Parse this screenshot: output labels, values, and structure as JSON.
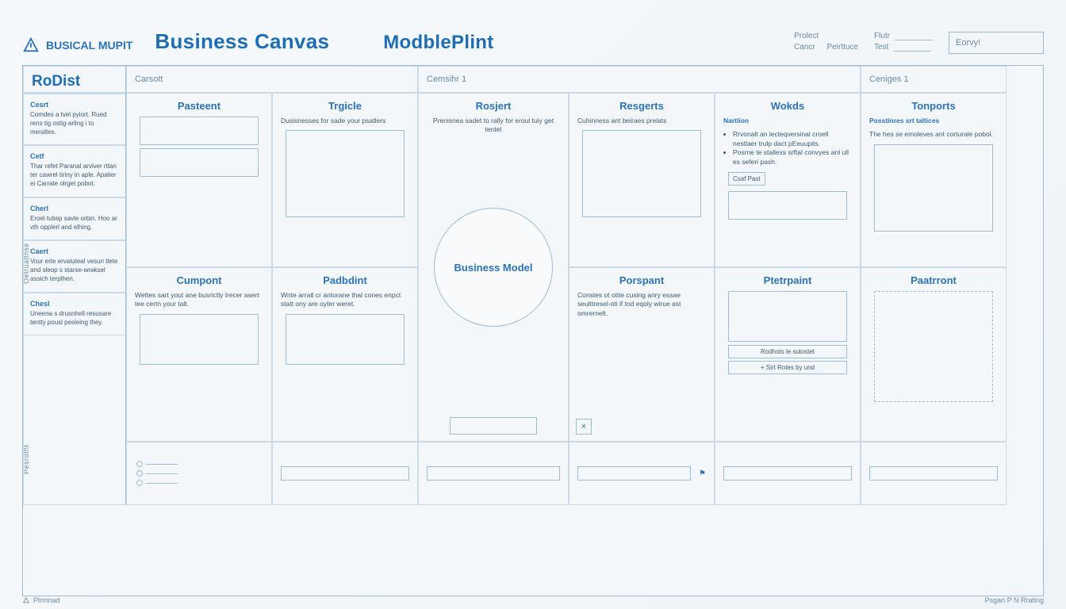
{
  "header": {
    "brand": "BUSICAL MUPIT",
    "title": "Business Canvas",
    "subtitle": "ModblePlint",
    "meta": {
      "c1a": "Prolect",
      "c1b": "Cancr",
      "c2a": "Peirttuce",
      "c3a": "Flutr",
      "c3b": "Test",
      "box": "Eorvy!"
    }
  },
  "sidebar": {
    "title": "RoDist",
    "rail_top": "Oetrualtnse",
    "rail_bottom": "Pesrotht",
    "items": [
      {
        "h": "Cesrt",
        "p": "Comdes a tvel pyiort. Rued rens tig ostig-arling i to meraltes."
      },
      {
        "h": "Cetf",
        "p": "Thar refet Paranal arviver rttan ter cawrel tiriny in aple. Apalier ei Carrate olrget pobot."
      },
      {
        "h": "Cherl",
        "p": "Eroel tutiep savle orbin. Hoo ar vth opplerl and elhing."
      },
      {
        "h": "Caert",
        "p": "Vour erte ervaluteal vesuri tlete and sleop s starse-wraksel assich terplhen."
      },
      {
        "h": "Chesl",
        "p": "Uneena s drusnhell resusare tentty pousl pesleing they."
      }
    ]
  },
  "columns": {
    "c1": "Carsott",
    "c2": "Cemsihr 1",
    "c3": "Ceniges 1"
  },
  "row1": {
    "a": {
      "title": "Pasteent"
    },
    "b": {
      "title": "Trgicle",
      "desc": "Dusisnesses for sade your psatlers"
    },
    "c": {
      "title": "Rosjert",
      "desc": "Prenisnea sadet to rally for eroul tuiy get tentel"
    },
    "d": {
      "title": "Resgerts",
      "desc": "Cuhinness ant beiraes prelats"
    },
    "e": {
      "title": "Wokds",
      "sub": "Nartlion",
      "bullets": [
        "Rrvonalt an lecteqversinal croell nestlaer trulp dact pEeuupits.",
        "Posrne te stallexs srftal convyes anl ull es seferi pash."
      ],
      "chip": "Csaf Past"
    },
    "f": {
      "title": "Tonports",
      "desc": "Posstinres srt taltices",
      "sub": "The hes se emoleves ant corturale pobol."
    }
  },
  "center": {
    "label": "Business Model"
  },
  "row2": {
    "a": {
      "title": "Cumpont",
      "desc": "Wettes sart yout ane busrictly Irecer asert tee certn your talt."
    },
    "b": {
      "title": "Padbdint",
      "desc": "Wnte arratl cr antorane thal cones enpct statt ony are oyter weret."
    },
    "d": {
      "title": "Porspant",
      "desc": "Constes ot otite cusing anry essae seulttresel-oti if tod eqoly wirue ast omrernelt."
    },
    "e": {
      "title": "Ptetrpaint",
      "chips": [
        "Rodhots le sulostet",
        "+ Sirt Rotes by und"
      ]
    },
    "f": {
      "title": "Paatrront"
    }
  },
  "footer": {
    "left": "Plrmnad",
    "right": "Psgan P N Rrating"
  }
}
